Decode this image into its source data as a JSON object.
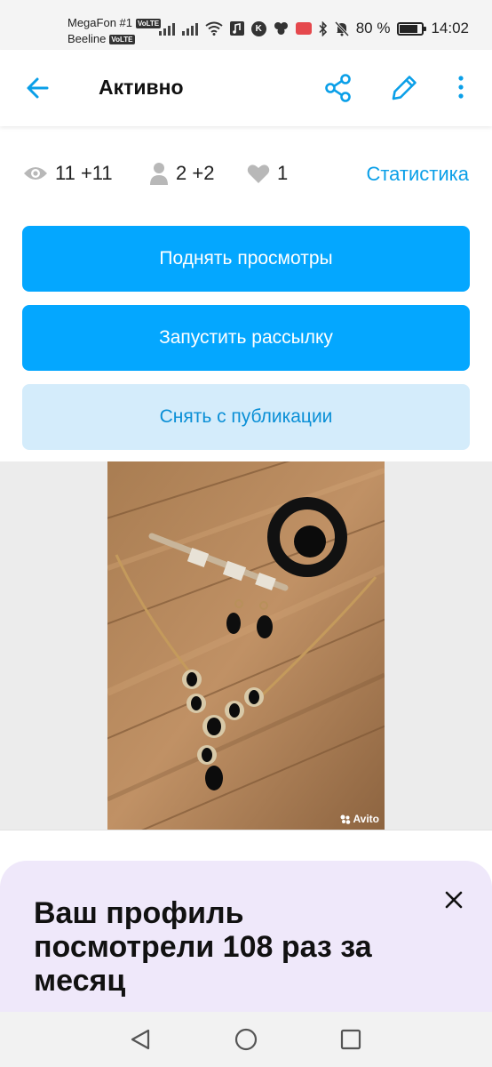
{
  "status_bar": {
    "carrier1": "MegaFon #1",
    "carrier2": "Beeline",
    "volte": "VoLTE",
    "battery": "80 %",
    "battery_level": 0.8,
    "time": "14:02"
  },
  "app_bar": {
    "title": "Активно",
    "icons": [
      "arrow-left-icon",
      "share-icon",
      "pencil-icon",
      "more-vertical-icon"
    ],
    "accent_color": "#0a9fe8"
  },
  "stats": {
    "views": "11 +11",
    "contacts": "2 +2",
    "favorites": "1",
    "link": "Статистика"
  },
  "actions": {
    "raise_views": "Поднять просмотры",
    "start_mailing": "Запустить рассылку",
    "unpublish": "Снять с публикации",
    "primary_color": "#04a7ff",
    "secondary_color": "#d4ecfb"
  },
  "photo": {
    "watermark": "Avito"
  },
  "banner": {
    "text": "Ваш профиль посмотрели 108 раз за месяц",
    "background": "#efe8fa"
  },
  "nav_bar": {
    "icons": [
      "triangle-back-icon",
      "circle-home-icon",
      "square-recents-icon"
    ]
  }
}
